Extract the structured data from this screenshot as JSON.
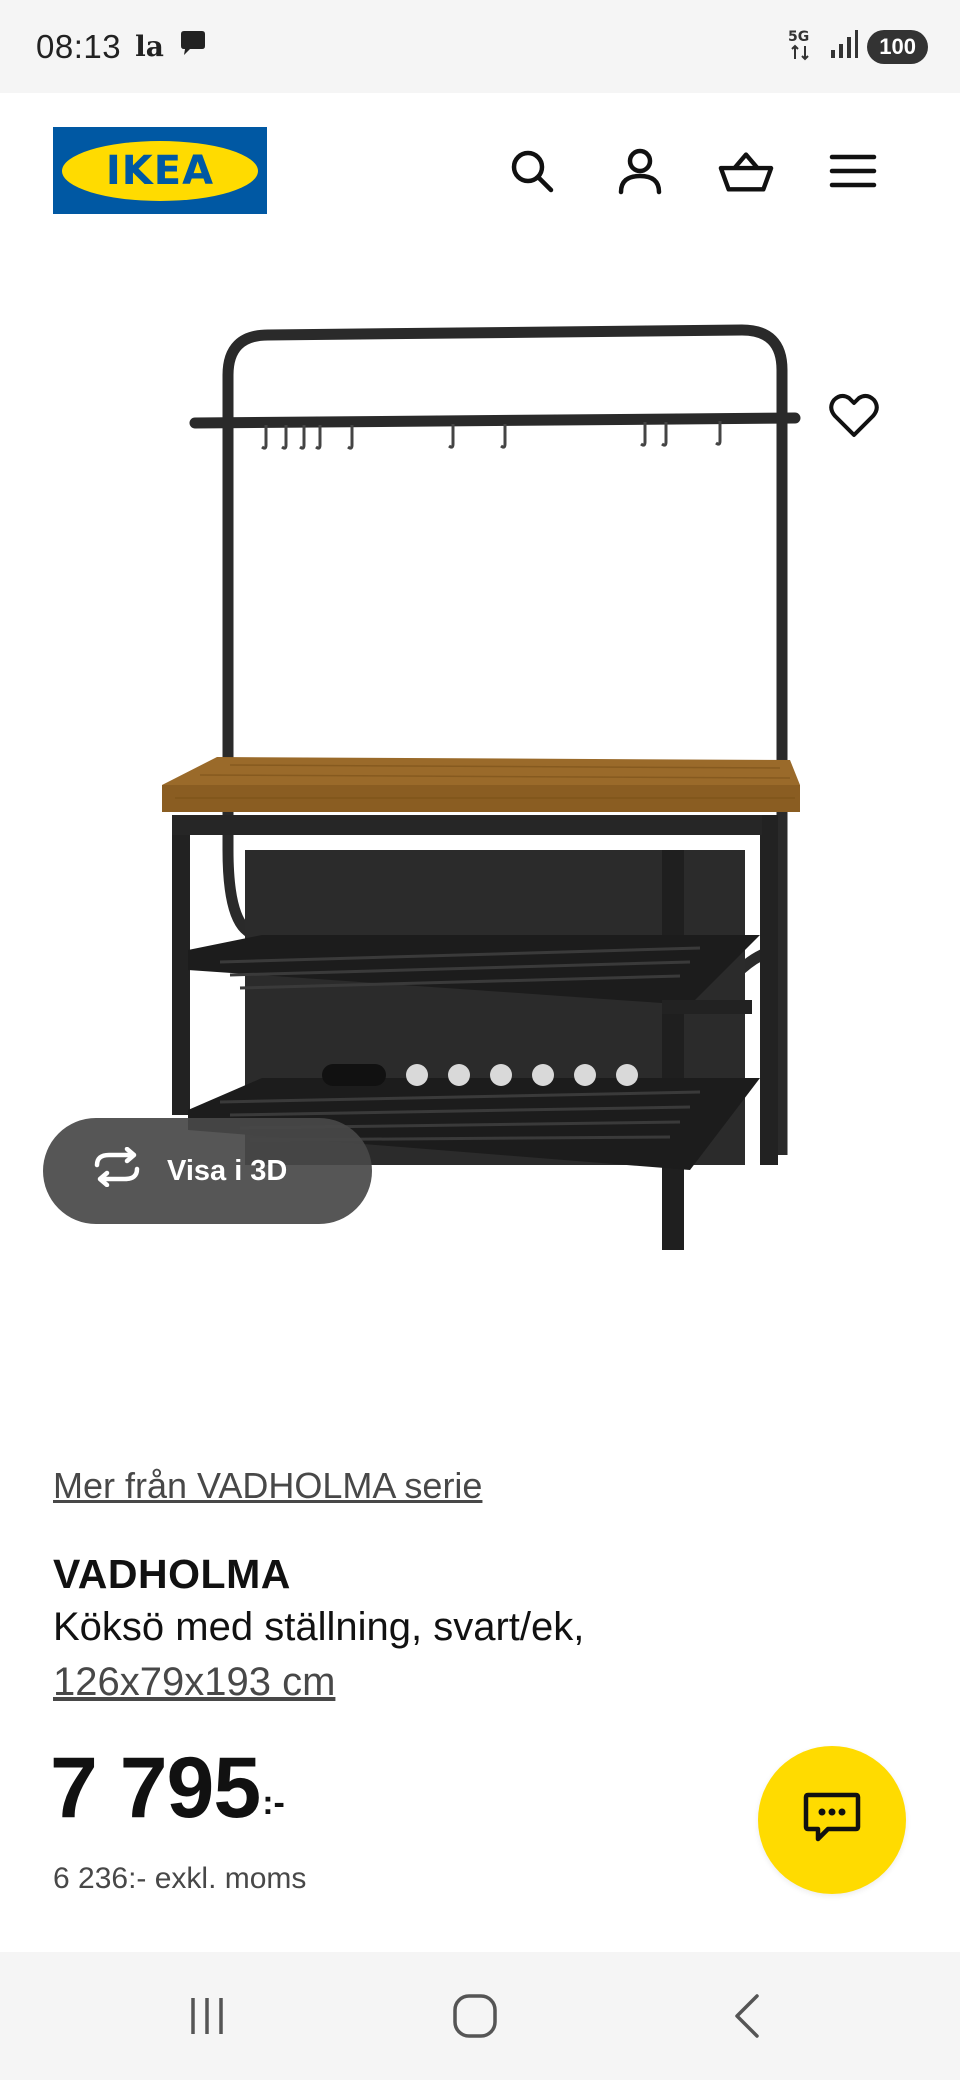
{
  "status_bar": {
    "time": "08:13",
    "app_indicator": "la",
    "network": "5G",
    "battery": "100"
  },
  "header": {
    "logo_text": "IKEA",
    "icons": [
      "search-icon",
      "account-icon",
      "basket-icon",
      "menu-icon"
    ]
  },
  "gallery": {
    "visa3d_label": "Visa i 3D",
    "dot_count": 7,
    "active_dot": 1
  },
  "product": {
    "series_link": "Mer från VADHOLMA serie",
    "name": "VADHOLMA",
    "description": "Köksö med ställning, svart/ek,",
    "size": "126x79x193 cm",
    "price_main": "7 795",
    "price_suffix": ":-",
    "price_ex_vat": "6 236:- exkl. moms"
  },
  "colors": {
    "ikea_blue": "#0058a3",
    "ikea_yellow": "#ffdb00",
    "text_dark": "#111111",
    "text_muted": "#484848"
  }
}
